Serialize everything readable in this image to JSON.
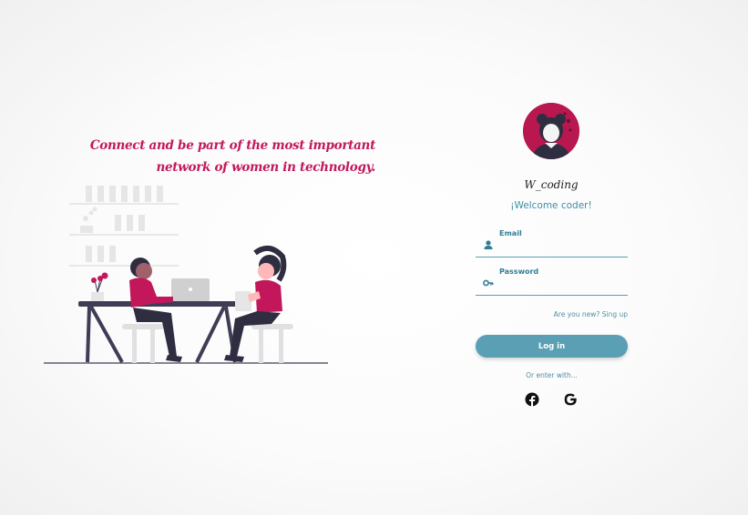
{
  "hero": {
    "tagline": "Connect and be part of the most important network of women in technology."
  },
  "login": {
    "brand": "W_coding",
    "welcome": "¡Welcome coder!",
    "email_label": "Email",
    "password_label": "Password",
    "signup_link": "Are you new? Sing up",
    "login_button": "Log in",
    "or_enter": "Or enter with..."
  },
  "icons": {
    "email": "user-icon",
    "password": "key-icon",
    "social": [
      "facebook-icon",
      "google-icon"
    ]
  },
  "colors": {
    "accent_pink": "#c2185b",
    "accent_teal": "#5a9fb3",
    "avatar_bg": "#b8174f",
    "dark": "#3f3d56"
  }
}
